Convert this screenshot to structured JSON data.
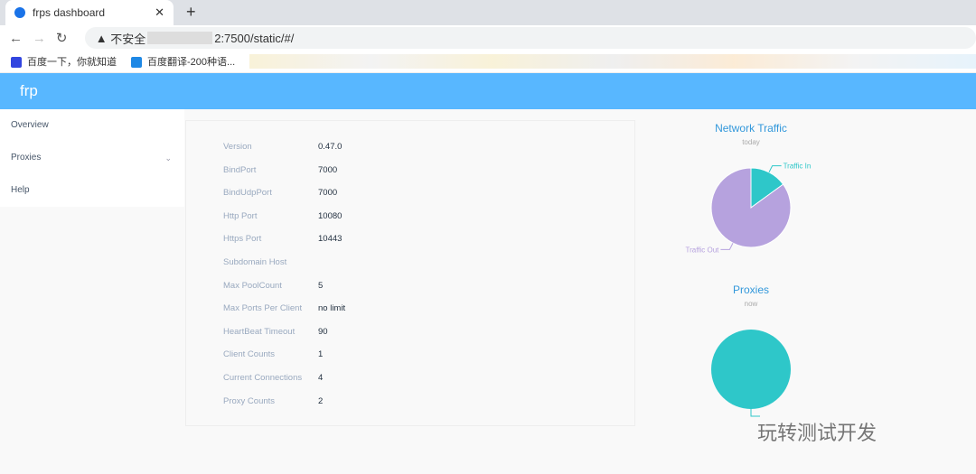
{
  "browser": {
    "tab_title": "frps dashboard",
    "url_prefix": "不安全",
    "url_suffix": "2:7500/static/#/",
    "bookmarks": [
      "百度一下，你就知道",
      "百度翻译-200种语..."
    ]
  },
  "header": {
    "title": "frp"
  },
  "sidebar": {
    "items": [
      {
        "label": "Overview"
      },
      {
        "label": "Proxies"
      },
      {
        "label": "Help"
      }
    ]
  },
  "info": [
    {
      "k": "Version",
      "v": "0.47.0"
    },
    {
      "k": "BindPort",
      "v": "7000"
    },
    {
      "k": "BindUdpPort",
      "v": "7000"
    },
    {
      "k": "Http Port",
      "v": "10080"
    },
    {
      "k": "Https Port",
      "v": "10443"
    },
    {
      "k": "Subdomain Host",
      "v": ""
    },
    {
      "k": "Max PoolCount",
      "v": "5"
    },
    {
      "k": "Max Ports Per Client",
      "v": "no limit"
    },
    {
      "k": "HeartBeat Timeout",
      "v": "90"
    },
    {
      "k": "Client Counts",
      "v": "1"
    },
    {
      "k": "Current Connections",
      "v": "4"
    },
    {
      "k": "Proxy Counts",
      "v": "2"
    }
  ],
  "chart_data": [
    {
      "type": "pie",
      "title": "Network Traffic",
      "subtitle": "today",
      "categories": [
        "Traffic In",
        "Traffic Out"
      ],
      "values": [
        15,
        85
      ],
      "colors": [
        "#2ec7c9",
        "#b6a2de"
      ]
    },
    {
      "type": "pie",
      "title": "Proxies",
      "subtitle": "now",
      "categories": [
        ""
      ],
      "values": [
        100
      ],
      "colors": [
        "#2ec7c9"
      ]
    }
  ],
  "watermark": "玩转测试开发"
}
